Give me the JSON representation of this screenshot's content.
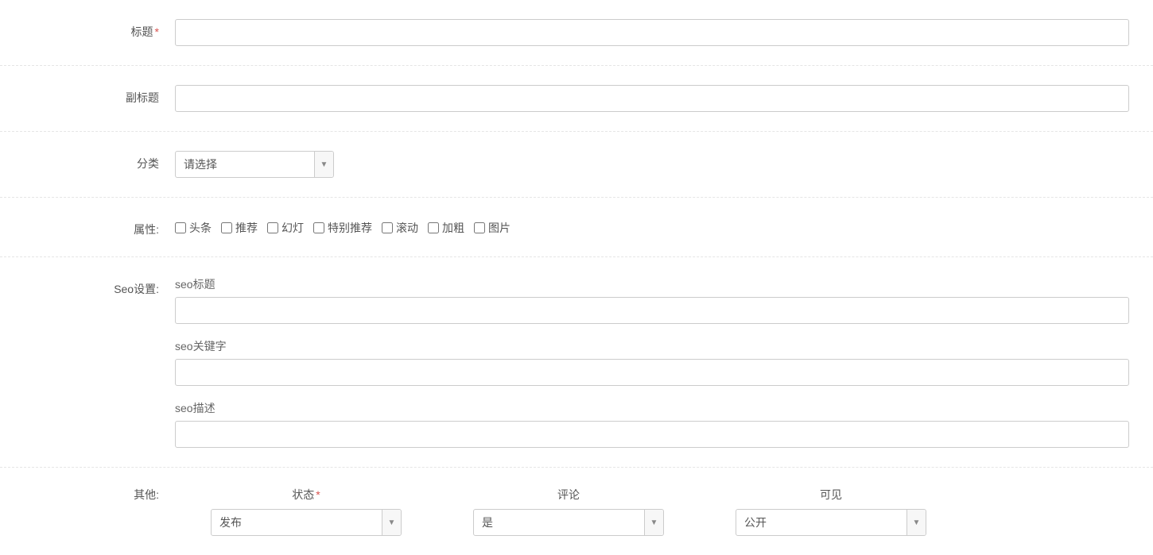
{
  "labels": {
    "title": "标题",
    "subtitle": "副标题",
    "category": "分类",
    "attributes": "属性:",
    "seo_settings": "Seo设置:",
    "other": "其他:"
  },
  "category": {
    "selected": "请选择"
  },
  "attributes": {
    "items": [
      "头条",
      "推荐",
      "幻灯",
      "特别推荐",
      "滚动",
      "加粗",
      "图片"
    ]
  },
  "seo": {
    "title_label": "seo标题",
    "keywords_label": "seo关键字",
    "description_label": "seo描述"
  },
  "other": {
    "status_label": "状态",
    "status_value": "发布",
    "comment_label": "评论",
    "comment_value": "是",
    "visibility_label": "可见",
    "visibility_value": "公开"
  }
}
